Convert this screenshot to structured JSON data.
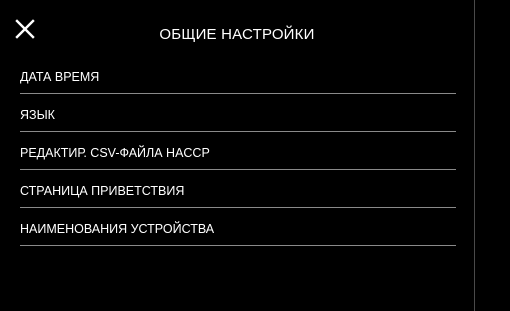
{
  "header": {
    "title": "ОБЩИЕ НАСТРОЙКИ",
    "close_icon": "close-icon"
  },
  "menu": {
    "items": [
      {
        "label": "ДАТА  ВРЕМЯ"
      },
      {
        "label": "ЯЗЫК"
      },
      {
        "label": "РЕДАКТИР. CSV-ФАЙЛА HACCP"
      },
      {
        "label": "СТРАНИЦА ПРИВЕТСТВИЯ"
      },
      {
        "label": "НАИМЕНОВАНИЯ УСТРОЙСТВА"
      }
    ]
  },
  "colors": {
    "background": "#000000",
    "text": "#ffffff",
    "divider": "#8a8a8a"
  }
}
